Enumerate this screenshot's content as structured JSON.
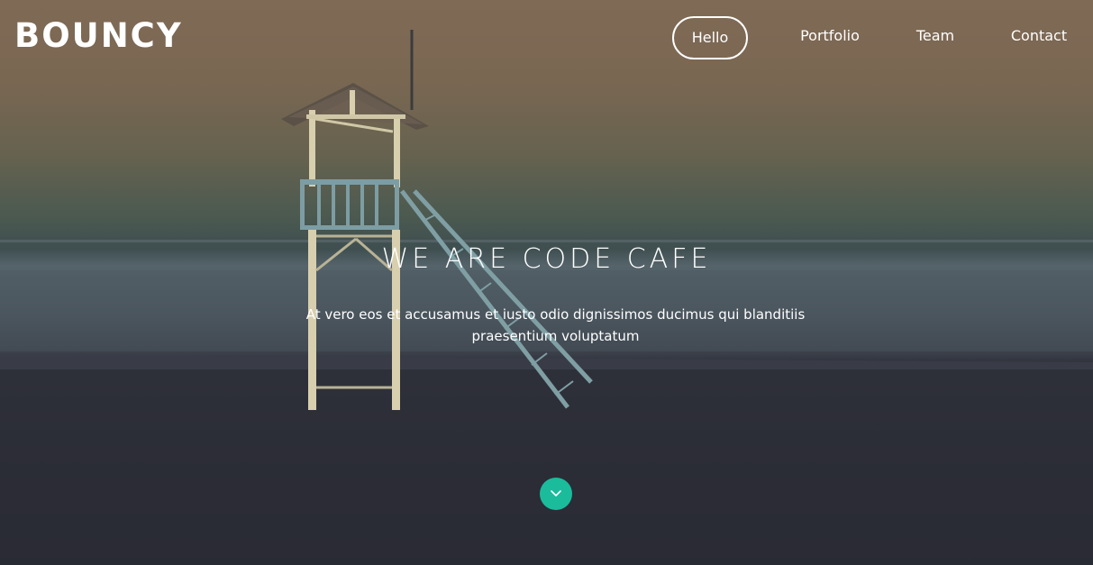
{
  "brand": {
    "logo_text": "BOUNCY"
  },
  "nav": {
    "items": [
      {
        "label": "Hello",
        "active": true
      },
      {
        "label": "Portfolio",
        "active": false
      },
      {
        "label": "Team",
        "active": false
      },
      {
        "label": "Contact",
        "active": false
      }
    ]
  },
  "hero": {
    "headline": "WE ARE CODE CAFE",
    "subtext": "At vero eos et accusamus et iusto odio dignissimos ducimus qui blanditiis praesentium voluptatum",
    "background_image": "lifeguard-tower-on-beach-at-dusk",
    "scroll_button_icon": "chevron-down-icon"
  },
  "colors": {
    "accent": "#1abc9c",
    "text": "#ffffff"
  }
}
